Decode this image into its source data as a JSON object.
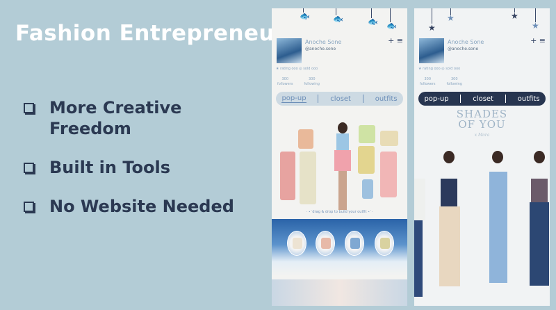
{
  "slide": {
    "title": "Fashion Entrepreneurs",
    "bullets": [
      "More Creative Freedom",
      "Built in Tools",
      "No Website Needed"
    ]
  },
  "screens": [
    {
      "username": "Anoche Sone",
      "handle": "@anoche.sone",
      "rating": "★ rating ooo  ◎ sold ooo",
      "followers_count": "300",
      "followers_label": "followers",
      "following_count": "300",
      "following_label": "following",
      "tabs": [
        "pop-up",
        "closet",
        "outfits"
      ],
      "hint": "· ⋆˙drag & drop to build your outfit ⋆˙·"
    },
    {
      "username": "Anoche Sone",
      "handle": "@anoche.sone",
      "rating": "★ rating ooo  ◎ sold ooo",
      "followers_count": "300",
      "followers_label": "followers",
      "following_count": "300",
      "following_label": "following",
      "tabs": [
        "pop-up",
        "closet",
        "outfits"
      ],
      "banner_title": "SHADES OF YOU",
      "banner_script": "x Mora"
    }
  ],
  "icons": {
    "charm_fish": "fish-icon",
    "charm_star": "star-icon",
    "plus": "plus-icon",
    "menu": "menu-icon"
  },
  "colors": {
    "background": "#b3ccd6",
    "title": "#ffffff",
    "bullet_text": "#2b3952",
    "accent_light": "#cddae3",
    "accent_dark": "#273550"
  }
}
